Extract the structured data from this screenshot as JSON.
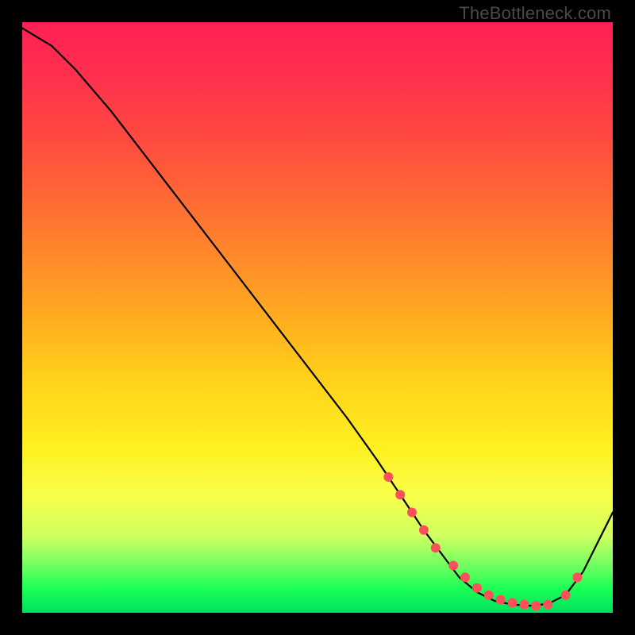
{
  "watermark": "TheBottleneck.com",
  "chart_data": {
    "type": "line",
    "title": "",
    "xlabel": "",
    "ylabel": "",
    "xlim": [
      0,
      100
    ],
    "ylim": [
      0,
      100
    ],
    "series": [
      {
        "name": "bottleneck-curve",
        "x": [
          0,
          5,
          9,
          15,
          25,
          35,
          45,
          55,
          60,
          64,
          68,
          71,
          74,
          77,
          80,
          83,
          86,
          89,
          92,
          95,
          100
        ],
        "y": [
          99,
          96,
          92,
          85,
          72,
          59,
          46,
          33,
          26,
          20,
          14,
          10,
          6,
          3.5,
          2,
          1.4,
          1.2,
          1.5,
          3,
          7,
          17
        ]
      }
    ],
    "markers": {
      "name": "highlighted-points",
      "x": [
        62,
        64,
        66,
        68,
        70,
        73,
        75,
        77,
        79,
        81,
        83,
        85,
        87,
        89,
        92,
        94
      ],
      "y": [
        23,
        20,
        17,
        14,
        11,
        8,
        6,
        4.2,
        3,
        2.2,
        1.7,
        1.4,
        1.2,
        1.4,
        3,
        6
      ]
    },
    "background": {
      "type": "vertical-gradient",
      "stops": [
        {
          "pos": 0.0,
          "color": "#ff1f55"
        },
        {
          "pos": 0.35,
          "color": "#ff7a2f"
        },
        {
          "pos": 0.6,
          "color": "#ffd01a"
        },
        {
          "pos": 0.8,
          "color": "#f8ff4a"
        },
        {
          "pos": 0.92,
          "color": "#70ff60"
        },
        {
          "pos": 1.0,
          "color": "#00e060"
        }
      ]
    }
  }
}
